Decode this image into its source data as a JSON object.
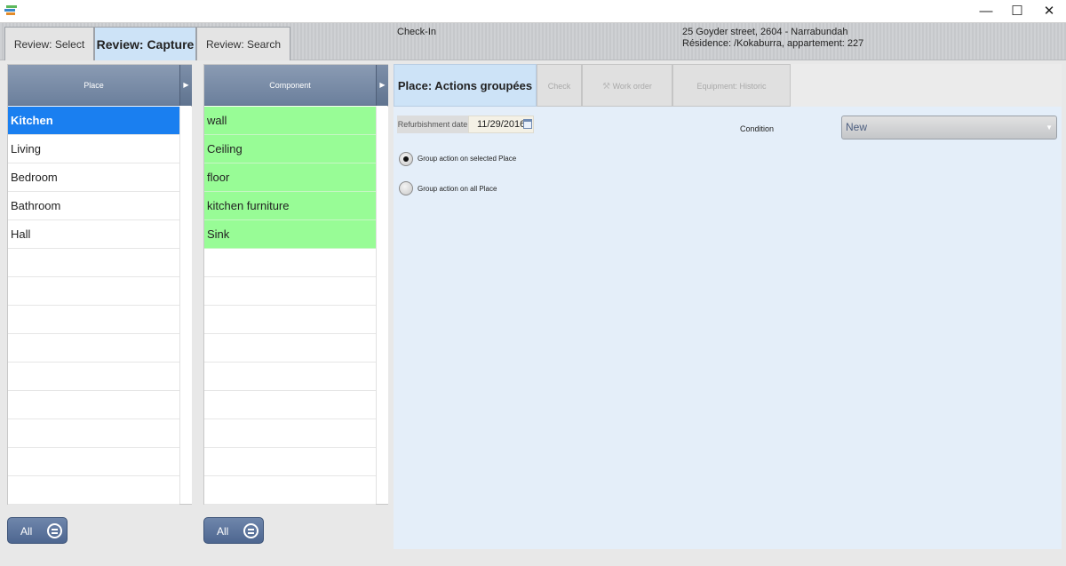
{
  "window": {
    "controls": {
      "minimize": "—",
      "maximize": "☐",
      "close": "✕"
    }
  },
  "header": {
    "tabs": [
      {
        "label": "Review: Select"
      },
      {
        "label": "Review: Capture"
      },
      {
        "label": "Review: Search"
      }
    ],
    "mode": "Check-In",
    "address_line1": "25 Goyder street, 2604 - Narrabundah",
    "address_line2": "Résidence: /Kokaburra, appartement: 227"
  },
  "place_list": {
    "header": "Place",
    "items": [
      "Kitchen",
      "Living",
      "Bedroom",
      "Bathroom",
      "Hall"
    ],
    "selected": "Kitchen",
    "all_button": "All"
  },
  "component_list": {
    "header": "Component",
    "items": [
      "wall",
      "Ceiling",
      "floor",
      "kitchen furniture",
      "Sink"
    ],
    "all_button": "All"
  },
  "actions": {
    "tabs": [
      {
        "label": "Place: Actions groupées"
      },
      {
        "label": "Check"
      },
      {
        "label": "Work order"
      },
      {
        "label": "Equipment: Historic"
      }
    ],
    "refurbishment_label": "Refurbishment date",
    "refurbishment_date": "11/29/2016",
    "condition_label": "Condition",
    "condition_value": "New",
    "radio_selected_label": "Group action on selected Place",
    "radio_all_label": "Group action on all Place"
  },
  "colors": {
    "selection": "#1a7ff0",
    "component_row": "#98fc96",
    "active_tab": "#cde3f7",
    "list_header": "#6b7f9c"
  }
}
